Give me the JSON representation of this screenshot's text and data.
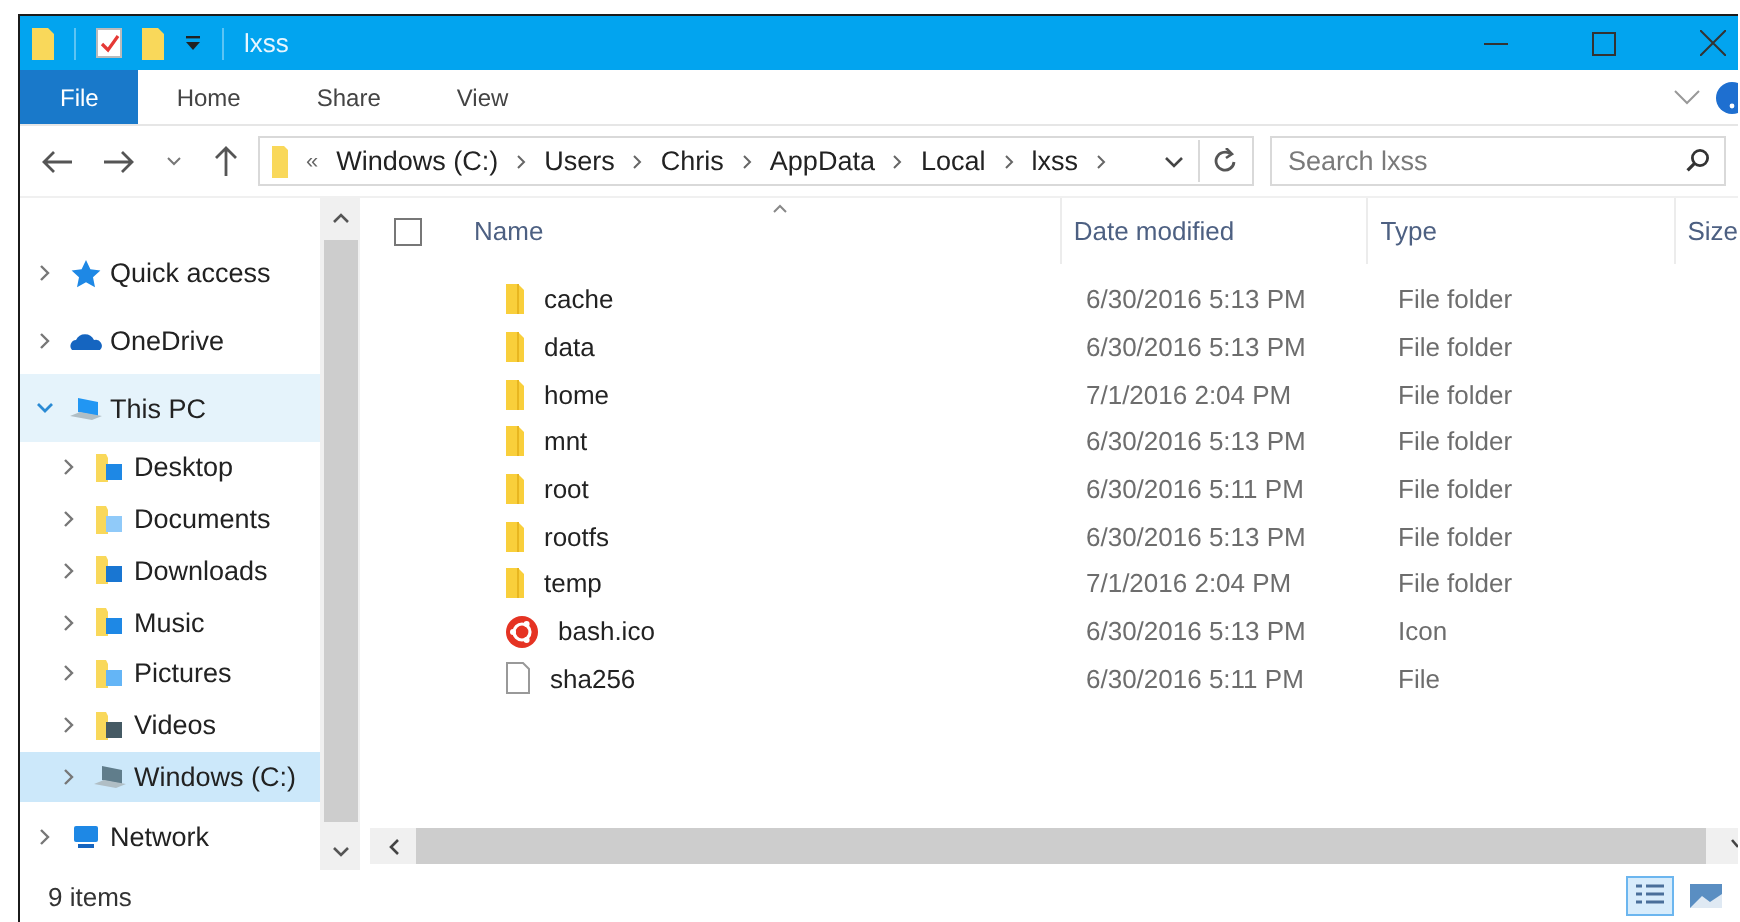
{
  "window": {
    "title": "lxss"
  },
  "ribbon_tabs": [
    {
      "label": "File",
      "kind": "file",
      "selected": false
    },
    {
      "label": "Home",
      "kind": "tab",
      "selected": false
    },
    {
      "label": "Share",
      "kind": "tab",
      "selected": false
    },
    {
      "label": "View",
      "kind": "tab",
      "selected": false
    }
  ],
  "address_bar": {
    "overflow": "«",
    "crumbs": [
      "Windows (C:)",
      "Users",
      "Chris",
      "AppData",
      "Local",
      "lxss"
    ]
  },
  "search": {
    "placeholder": "Search lxss"
  },
  "sidebar": {
    "items": [
      {
        "label": "Quick access",
        "kind": "star",
        "expanded": false,
        "selected": false,
        "hovered": false
      },
      {
        "label": "OneDrive",
        "kind": "cloud",
        "expanded": false,
        "selected": false,
        "hovered": false
      },
      {
        "label": "This PC",
        "kind": "pc",
        "expanded": true,
        "selected": false,
        "hovered": true,
        "children": [
          {
            "label": "Desktop",
            "kind": "desktop",
            "expanded": false,
            "selected": false,
            "hovered": false
          },
          {
            "label": "Documents",
            "kind": "documents",
            "expanded": false,
            "selected": false,
            "hovered": false
          },
          {
            "label": "Downloads",
            "kind": "downloads",
            "expanded": false,
            "selected": false,
            "hovered": false
          },
          {
            "label": "Music",
            "kind": "music",
            "expanded": false,
            "selected": false,
            "hovered": false
          },
          {
            "label": "Pictures",
            "kind": "pictures",
            "expanded": false,
            "selected": false,
            "hovered": false
          },
          {
            "label": "Videos",
            "kind": "videos",
            "expanded": false,
            "selected": false,
            "hovered": false
          },
          {
            "label": "Windows (C:)",
            "kind": "drive",
            "expanded": false,
            "selected": true,
            "hovered": false
          }
        ]
      },
      {
        "label": "Network",
        "kind": "network",
        "expanded": false,
        "selected": false,
        "hovered": false
      }
    ]
  },
  "table": {
    "select_all": {
      "checked": false
    },
    "columns": [
      "Name",
      "Date modified",
      "Type",
      "Size"
    ],
    "rows": [
      {
        "name": "cache",
        "kind": "folder",
        "date": "6/30/2016 5:13 PM",
        "type": "File folder"
      },
      {
        "name": "data",
        "kind": "folder",
        "date": "6/30/2016 5:13 PM",
        "type": "File folder"
      },
      {
        "name": "home",
        "kind": "folder",
        "date": "7/1/2016 2:04 PM",
        "type": "File folder"
      },
      {
        "name": "mnt",
        "kind": "folder",
        "date": "6/30/2016 5:13 PM",
        "type": "File folder"
      },
      {
        "name": "root",
        "kind": "folder",
        "date": "6/30/2016 5:11 PM",
        "type": "File folder"
      },
      {
        "name": "rootfs",
        "kind": "folder",
        "date": "6/30/2016 5:13 PM",
        "type": "File folder"
      },
      {
        "name": "temp",
        "kind": "folder",
        "date": "7/1/2016 2:04 PM",
        "type": "File folder"
      },
      {
        "name": "bash.ico",
        "kind": "ico",
        "date": "6/30/2016 5:13 PM",
        "type": "Icon"
      },
      {
        "name": "sha256",
        "kind": "file",
        "date": "6/30/2016 5:11 PM",
        "type": "File"
      }
    ]
  },
  "status_bar": {
    "count": "9 items",
    "views": [
      {
        "kind": "details",
        "selected": true
      },
      {
        "kind": "large",
        "selected": false
      }
    ]
  }
}
